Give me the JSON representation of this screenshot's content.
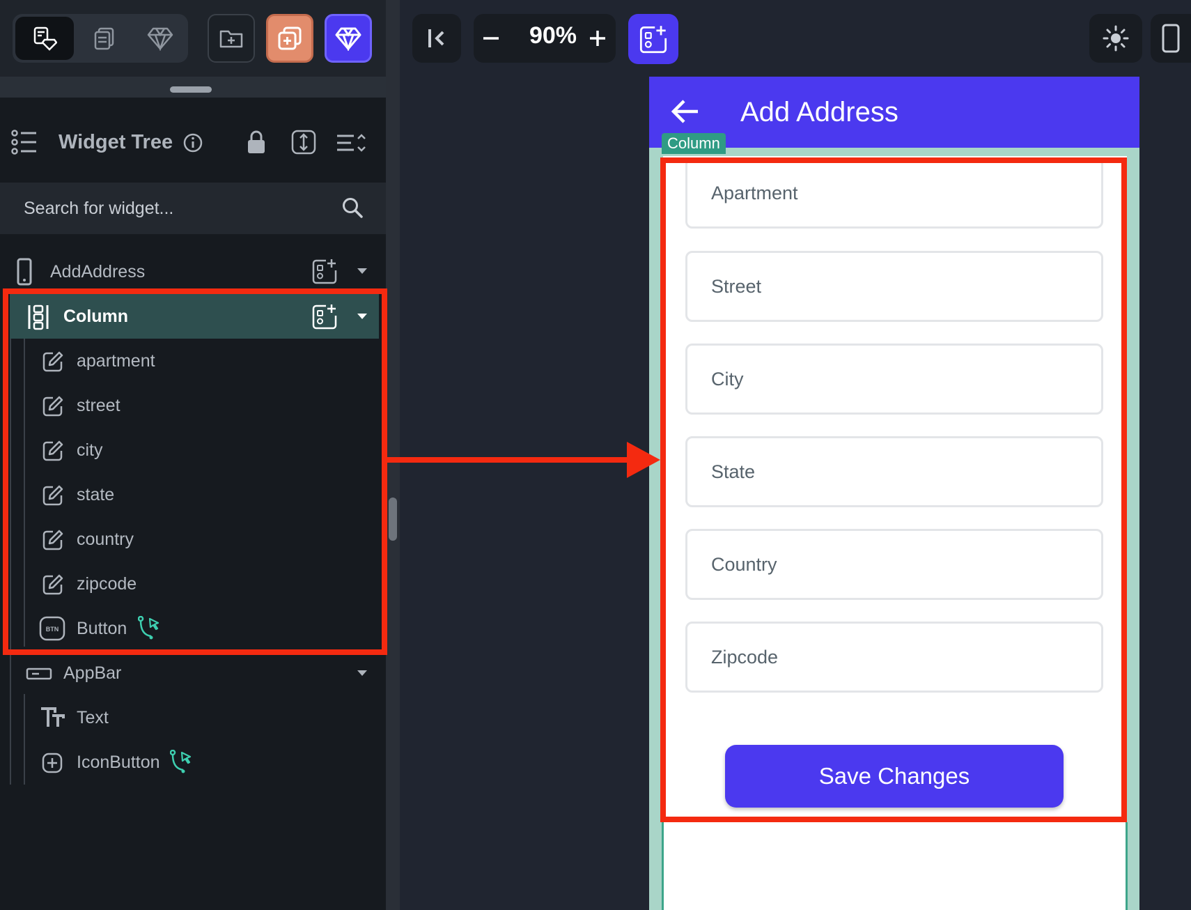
{
  "colors": {
    "brand_primary": "#4b39ef",
    "panel_bg": "#161a1f",
    "selected_row": "#2e4f4f",
    "column_overlay": "#a9d5c8",
    "column_tag": "#2f9b84",
    "annotation_red": "#f42a10",
    "connector_teal": "#3ecfb0"
  },
  "toolbar": {
    "icons": [
      "widget-palette-icon",
      "page-stack-icon",
      "gem-icon",
      "folder-add-icon",
      "copy-add-icon",
      "gem-icon"
    ]
  },
  "widget_tree": {
    "title": "Widget Tree",
    "search_placeholder": "Search for widget...",
    "items": [
      {
        "label": "AddAddress",
        "icon": "phone-icon",
        "level": 0
      },
      {
        "label": "Column",
        "icon": "column-icon",
        "level": 1,
        "selected": true
      },
      {
        "label": "apartment",
        "icon": "textfield-edit-icon",
        "level": 2
      },
      {
        "label": "street",
        "icon": "textfield-edit-icon",
        "level": 2
      },
      {
        "label": "city",
        "icon": "textfield-edit-icon",
        "level": 2
      },
      {
        "label": "state",
        "icon": "textfield-edit-icon",
        "level": 2
      },
      {
        "label": "country",
        "icon": "textfield-edit-icon",
        "level": 2
      },
      {
        "label": "zipcode",
        "icon": "textfield-edit-icon",
        "level": 2
      },
      {
        "label": "Button",
        "icon": "btn-icon",
        "level": 2,
        "has_action": true
      },
      {
        "label": "AppBar",
        "icon": "appbar-icon",
        "level": 1
      },
      {
        "label": "Text",
        "icon": "text-icon",
        "level": 2
      },
      {
        "label": "IconButton",
        "icon": "plus-box-icon",
        "level": 2,
        "has_action": true
      }
    ]
  },
  "canvas": {
    "zoom": "90%"
  },
  "preview": {
    "appbar_title": "Add Address",
    "column_tag": "Column",
    "fields": [
      "Apartment",
      "Street",
      "City",
      "State",
      "Country",
      "Zipcode"
    ],
    "save_button": "Save Changes"
  }
}
